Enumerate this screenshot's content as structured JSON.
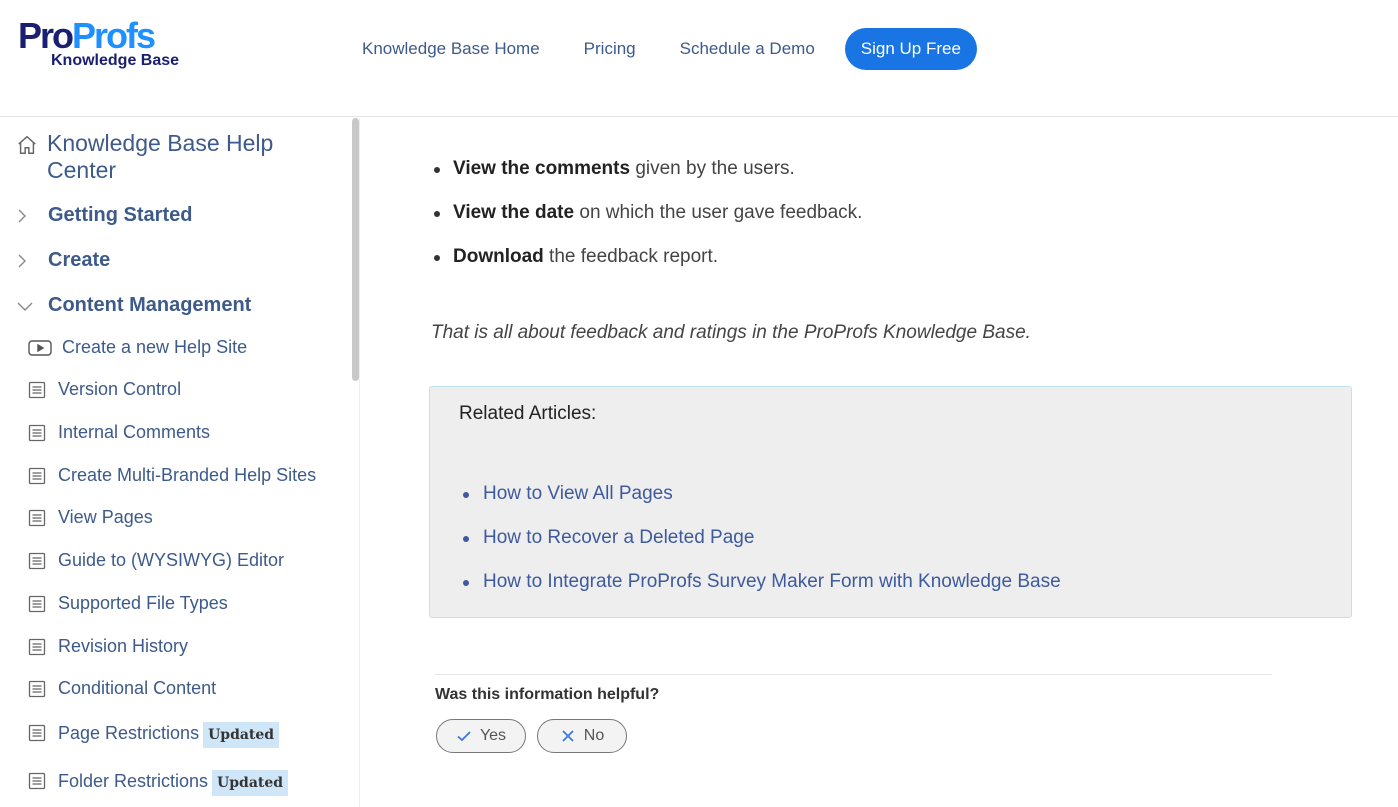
{
  "logo": {
    "part1": "Pro",
    "part2": "Profs",
    "sub": "Knowledge Base"
  },
  "nav": {
    "links": [
      "Knowledge Base Home",
      "Pricing",
      "Schedule a Demo"
    ],
    "signup": "Sign Up Free"
  },
  "sidebar": {
    "home": "Knowledge Base Help Center",
    "categories": [
      "Getting Started",
      "Create",
      "Content Management"
    ],
    "video_item": "Create a new Help Site",
    "items": [
      "Version Control",
      "Internal Comments",
      "Create Multi-Branded Help Sites",
      "View Pages",
      "Guide to (WYSIWYG) Editor",
      "Supported File Types",
      "Revision History",
      "Conditional Content",
      "Page Restrictions",
      "Folder Restrictions"
    ],
    "badge": "Updated"
  },
  "main": {
    "bullets": [
      {
        "bold": "View the comments",
        "rest": " given by the users."
      },
      {
        "bold": "View the date",
        "rest": " on which the user gave feedback."
      },
      {
        "bold": "Download",
        "rest": " the feedback report."
      }
    ],
    "summary": "That is all about feedback and ratings in the ProProfs Knowledge Base.",
    "related_title": "Related Articles:",
    "related": [
      "How to View All Pages",
      "How to Recover a Deleted Page",
      "How to Integrate ProProfs Survey Maker Form with Knowledge Base"
    ]
  },
  "feedback": {
    "question": "Was this information helpful?",
    "yes": "Yes",
    "no": "No"
  },
  "colors": {
    "accent": "#1875e3",
    "link": "#3d5a8a",
    "brand_dark": "#1a1f71"
  }
}
